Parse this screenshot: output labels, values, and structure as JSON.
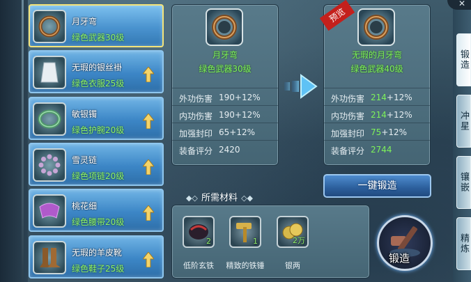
{
  "items": [
    {
      "name": "月牙弯",
      "grade": "绿色武器30级",
      "selected": true,
      "upgradable": false
    },
    {
      "name": "无瑕的银丝褂",
      "grade": "绿色衣服25级",
      "selected": false,
      "upgradable": true
    },
    {
      "name": "敏银镯",
      "grade": "绿色护腕20级",
      "selected": false,
      "upgradable": true
    },
    {
      "name": "雪灵链",
      "grade": "绿色项链20级",
      "selected": false,
      "upgradable": true
    },
    {
      "name": "桃花细",
      "grade": "绿色腰带20级",
      "selected": false,
      "upgradable": true
    },
    {
      "name": "无瑕的羊皮靴",
      "grade": "绿色鞋子25级",
      "selected": false,
      "upgradable": true
    }
  ],
  "current": {
    "name": "月牙弯",
    "grade": "绿色武器30级",
    "stats": [
      {
        "label": "外功伤害",
        "base": "190",
        "bonus": "+12%"
      },
      {
        "label": "内功伤害",
        "base": "190",
        "bonus": "+12%"
      },
      {
        "label": "加强封印",
        "base": "65",
        "bonus": "+12%"
      },
      {
        "label": "装备评分",
        "base": "2420",
        "bonus": ""
      }
    ]
  },
  "preview": {
    "badge": "预览",
    "name": "无瑕的月牙弯",
    "grade": "绿色武器40级",
    "stats": [
      {
        "label": "外功伤害",
        "base": "214",
        "bonus": "+12%"
      },
      {
        "label": "内功伤害",
        "base": "214",
        "bonus": "+12%"
      },
      {
        "label": "加强封印",
        "base": "75",
        "bonus": "+12%"
      },
      {
        "label": "装备评分",
        "base": "2744",
        "bonus": ""
      }
    ]
  },
  "one_click_label": "一键锻造",
  "materials_title": "所需材料",
  "materials": [
    {
      "name": "低阶玄铁",
      "count": "2",
      "icon": "black-ore-icon"
    },
    {
      "name": "精致的铁锤",
      "count": "1",
      "icon": "hammer-icon"
    },
    {
      "name": "银两",
      "count": "2万",
      "icon": "silver-coins-icon"
    }
  ],
  "forge_label": "锻造",
  "tabs": [
    {
      "label": "锻造",
      "active": true
    },
    {
      "label": "冲星",
      "active": false
    },
    {
      "label": "镶嵌",
      "active": false
    },
    {
      "label": "精炼",
      "active": false
    }
  ],
  "colors": {
    "accent_green": "#7ef25a",
    "item_blue": "#3c86c6",
    "selected_gold": "#f4e47a"
  }
}
